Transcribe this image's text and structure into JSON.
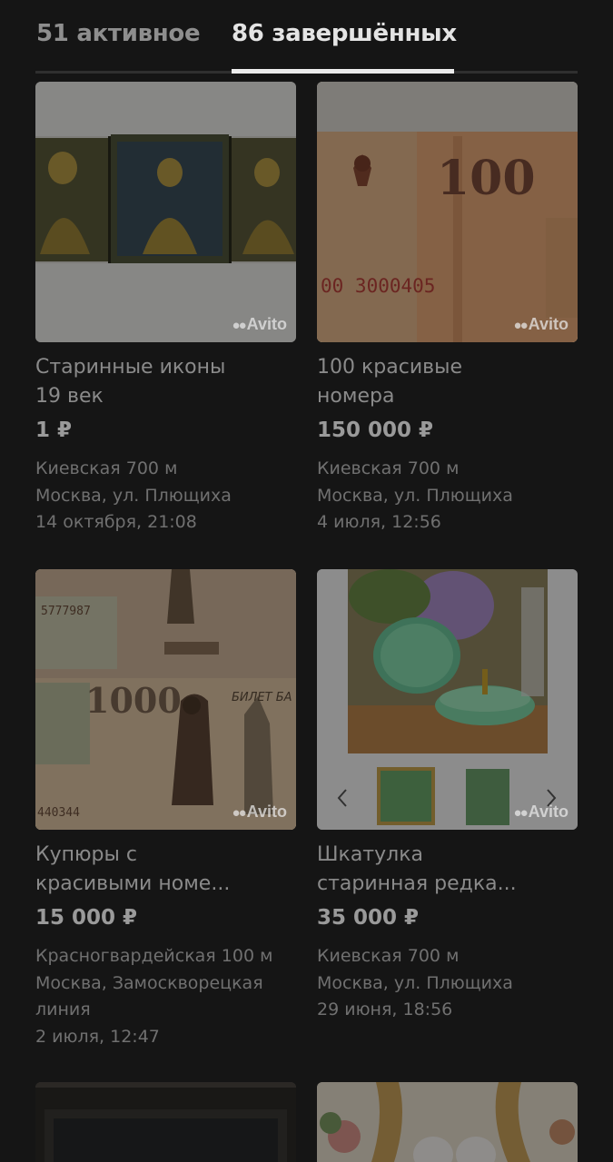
{
  "tabs": [
    {
      "label": "51 активное",
      "selected": false
    },
    {
      "label": "86 завершённых",
      "selected": true
    }
  ],
  "watermark": "Avito",
  "listings": [
    {
      "title_lines": [
        "Старинные иконы",
        "19 век"
      ],
      "price": "1 ₽",
      "meta_lines": [
        "Киевская 700 м",
        "Москва, ул. Плющиха",
        "14 октября, 21:08"
      ],
      "image": "icons-triptych"
    },
    {
      "title_lines": [
        "100 красивые",
        "номера"
      ],
      "price": "150 000 ₽",
      "meta_lines": [
        "Киевская 700 м",
        "Москва, ул. Плющиха",
        "4 июля, 12:56"
      ],
      "image": "banknote-100",
      "banknote_denomination": "100",
      "banknote_serial": "00 3000405"
    },
    {
      "title_lines": [
        "Купюры с",
        "красивыми номе..."
      ],
      "price": "15 000 ₽",
      "meta_lines": [
        "Красногвардейская 100 м",
        "Москва, Замоскворецкая",
        "линия",
        "2 июля, 12:47"
      ],
      "image": "banknote-1000",
      "banknote_denomination": "1000",
      "banknote_serial": "5777987",
      "banknote_serial_2": "440344",
      "banknote_label": "БИЛЕТ БА"
    },
    {
      "title_lines": [
        "Шкатулка",
        "старинная редка..."
      ],
      "price": "35 000 ₽",
      "meta_lines": [
        "Киевская 700 м",
        "Москва, ул. Плющиха",
        "29 июня, 18:56"
      ],
      "image": "green-box"
    },
    {
      "image": "dark-frame"
    },
    {
      "image": "gold-frame"
    }
  ]
}
